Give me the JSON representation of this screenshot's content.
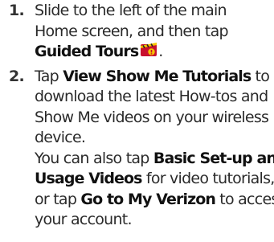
{
  "steps": [
    {
      "number": "1.",
      "lines": [
        [
          {
            "text": "Slide to the left of the main"
          }
        ],
        [
          {
            "text": "Home screen, and then tap"
          }
        ],
        [
          {
            "text": "Guided Tours",
            "bold": true
          },
          {
            "icon": "guided-tours-icon"
          },
          {
            "text": "."
          }
        ]
      ]
    },
    {
      "number": "2.",
      "lines": [
        [
          {
            "text": "Tap "
          },
          {
            "text": "View Show Me Tutorials",
            "bold": true
          },
          {
            "text": " to"
          }
        ],
        [
          {
            "text": "download the latest How-tos and"
          }
        ],
        [
          {
            "text": "Show Me videos on your wireless"
          }
        ],
        [
          {
            "text": "device."
          }
        ],
        [
          {
            "text": "You can also tap "
          },
          {
            "text": "Basic Set-up and",
            "bold": true
          }
        ],
        [
          {
            "text": "Usage Videos",
            "bold": true
          },
          {
            "text": " for video tutorials,"
          }
        ],
        [
          {
            "text": "or tap "
          },
          {
            "text": "Go to My Verizon",
            "bold": true
          },
          {
            "text": " to access"
          }
        ],
        [
          {
            "text": "your account."
          }
        ]
      ]
    }
  ],
  "colors": {
    "text": "#2a2a2a",
    "icon_red": "#c8102e",
    "icon_yellow": "#f5c400"
  }
}
